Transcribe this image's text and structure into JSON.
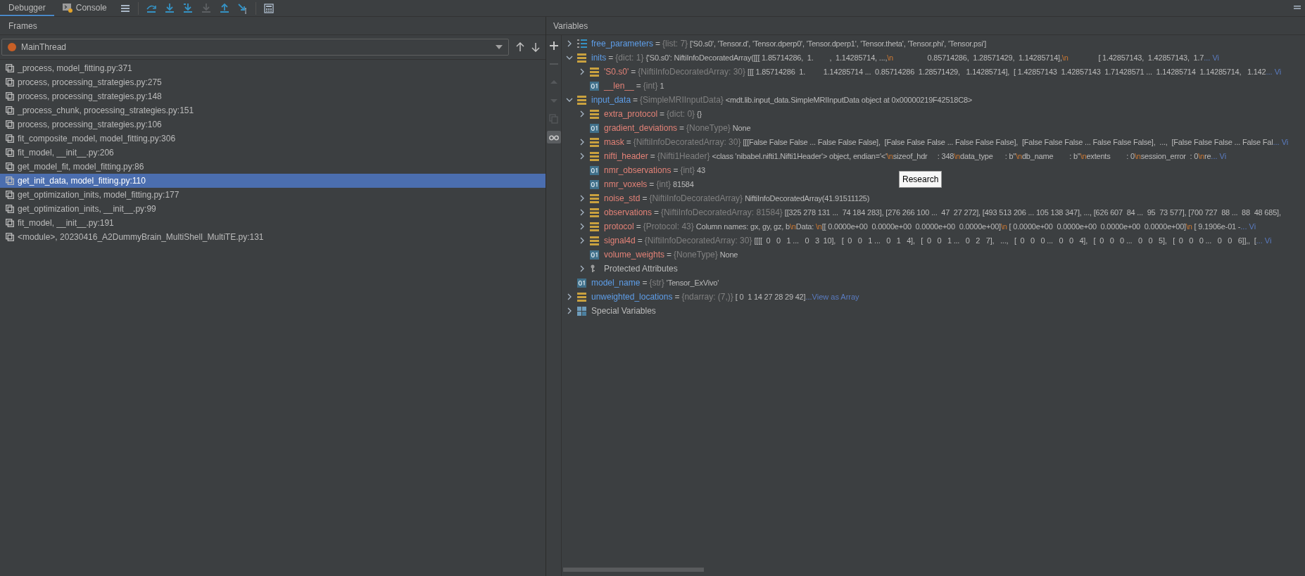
{
  "toolbar": {
    "tabs": [
      {
        "label": "Debugger",
        "selected": true,
        "kind": "plain"
      },
      {
        "label": "Console",
        "selected": false,
        "kind": "console"
      }
    ],
    "actions": [
      {
        "kind": "menu",
        "disabled": false
      },
      {
        "kind": "step-over",
        "disabled": false
      },
      {
        "kind": "step-into",
        "disabled": false
      },
      {
        "kind": "step-into-mine",
        "disabled": false
      },
      {
        "kind": "force-step-into",
        "disabled": true
      },
      {
        "kind": "step-out",
        "disabled": false
      },
      {
        "kind": "run-to-cursor",
        "disabled": false
      },
      {
        "kind": "evaluate",
        "disabled": false
      }
    ]
  },
  "frames": {
    "title": "Frames",
    "thread": {
      "name": "MainThread"
    },
    "items": [
      {
        "label": "_process, model_fitting.py:371",
        "selected": false
      },
      {
        "label": "process, processing_strategies.py:275",
        "selected": false
      },
      {
        "label": "process, processing_strategies.py:148",
        "selected": false
      },
      {
        "label": "_process_chunk, processing_strategies.py:151",
        "selected": false
      },
      {
        "label": "process, processing_strategies.py:106",
        "selected": false
      },
      {
        "label": "fit_composite_model, model_fitting.py:306",
        "selected": false
      },
      {
        "label": "fit_model, __init__.py:206",
        "selected": false
      },
      {
        "label": "get_model_fit, model_fitting.py:86",
        "selected": false
      },
      {
        "label": "get_init_data, model_fitting.py:110",
        "selected": true
      },
      {
        "label": "get_optimization_inits, model_fitting.py:177",
        "selected": false
      },
      {
        "label": "get_optimization_inits, __init__.py:99",
        "selected": false
      },
      {
        "label": "fit_model, __init__.py:191",
        "selected": false
      },
      {
        "label": "<module>, 20230416_A2DummyBrain_MultiShell_MultiTE.py:131",
        "selected": false
      }
    ]
  },
  "variables": {
    "title": "Variables",
    "separator": "=",
    "gutter": [
      {
        "kind": "add",
        "disabled": false,
        "selected": false
      },
      {
        "kind": "remove",
        "disabled": true,
        "selected": false
      },
      {
        "kind": "up",
        "disabled": true,
        "selected": false
      },
      {
        "kind": "down",
        "disabled": true,
        "selected": false
      },
      {
        "kind": "copy",
        "disabled": true,
        "selected": false
      },
      {
        "kind": "watch",
        "disabled": false,
        "selected": true
      }
    ],
    "rows": [
      {
        "kind": "list",
        "name": "free_parameters",
        "type": "{list: 7}",
        "expanded": false,
        "value": [
          {
            "text": "['S0.s0', 'Tensor.d', 'Tensor.dperp0', 'Tensor.dperp1', 'Tensor.theta', 'Tensor.phi', 'Tensor.psi']",
            "escape": false
          }
        ]
      },
      {
        "kind": "bars",
        "name": "inits",
        "type": "{dict: 1}",
        "expanded": true,
        "value": [
          {
            "text": "{'S0.s0': NiftiInfoDecoratedArray([[[ 1.85714286,  1.        ,  1.14285714, ...,",
            "escape": false
          },
          {
            "text": "\\n",
            "escape": true
          },
          {
            "text": "                 0.85714286,  1.28571429,  1.14285714],",
            "escape": false
          },
          {
            "text": "\\n",
            "escape": true
          },
          {
            "text": "               [ 1.42857143,  1.42857143,  1.7",
            "escape": false
          }
        ],
        "link": "... Vi",
        "children": [
          {
            "kind": "bars",
            "name": "'S0.s0'",
            "type": "{NiftiInfoDecoratedArray: 30}",
            "expanded": false,
            "value": [
              {
                "text": "[[[ 1.85714286  1.         1.14285714 ...  0.85714286  1.28571429,   1.14285714],  [ 1.42857143  1.42857143  1.71428571 ...  1.14285714  1.14285714,   1.142",
                "escape": false
              }
            ],
            "link": "... Vi"
          },
          {
            "kind": "int",
            "name": "__len__",
            "type": "{int}",
            "value": [
              {
                "text": "1",
                "escape": false
              }
            ]
          }
        ]
      },
      {
        "kind": "bars",
        "name": "input_data",
        "type": "{SimpleMRIInputData}",
        "expanded": true,
        "value": [
          {
            "text": "<mdt.lib.input_data.SimpleMRIInputData object at 0x00000219F42518C8>",
            "escape": false
          }
        ],
        "children": [
          {
            "kind": "bars",
            "name": "extra_protocol",
            "type": "{dict: 0}",
            "expanded": false,
            "value": [
              {
                "text": "{}",
                "escape": false
              }
            ]
          },
          {
            "kind": "int",
            "name": "gradient_deviations",
            "type": "{NoneType}",
            "value": [
              {
                "text": "None",
                "escape": false
              }
            ]
          },
          {
            "kind": "bars",
            "name": "mask",
            "type": "{NiftiInfoDecoratedArray: 30}",
            "expanded": false,
            "value": [
              {
                "text": "[[[False False False ... False False False],  [False False False ... False False False],  [False False False ... False False False],  ...,  [False False False ... False Fal",
                "escape": false
              }
            ],
            "link": "... Vi"
          },
          {
            "kind": "bars",
            "name": "nifti_header",
            "type": "{Nifti1Header}",
            "expanded": false,
            "value": [
              {
                "text": "<class 'nibabel.nifti1.Nifti1Header'> object, endian='<'",
                "escape": false
              },
              {
                "text": "\\n",
                "escape": true
              },
              {
                "text": "sizeof_hdr     : 348",
                "escape": false
              },
              {
                "text": "\\n",
                "escape": true
              },
              {
                "text": "data_type      : b''",
                "escape": false
              },
              {
                "text": "\\n",
                "escape": true
              },
              {
                "text": "db_name        : b''",
                "escape": false
              },
              {
                "text": "\\n",
                "escape": true
              },
              {
                "text": "extents        : 0",
                "escape": false
              },
              {
                "text": "\\n",
                "escape": true
              },
              {
                "text": "session_error  : 0",
                "escape": false
              },
              {
                "text": "\\n",
                "escape": true
              },
              {
                "text": "re",
                "escape": false
              }
            ],
            "link": "... Vi"
          },
          {
            "kind": "int",
            "name": "nmr_observations",
            "type": "{int}",
            "value": [
              {
                "text": "43",
                "escape": false
              }
            ]
          },
          {
            "kind": "int",
            "name": "nmr_voxels",
            "type": "{int}",
            "value": [
              {
                "text": "81584",
                "escape": false
              }
            ]
          },
          {
            "kind": "bars",
            "name": "noise_std",
            "type": "{NiftiInfoDecoratedArray}",
            "expanded": false,
            "value": [
              {
                "text": "NiftiInfoDecoratedArray(41.91511125)",
                "escape": false
              }
            ]
          },
          {
            "kind": "bars",
            "name": "observations",
            "type": "{NiftiInfoDecoratedArray: 81584}",
            "expanded": false,
            "value": [
              {
                "text": "[[325 278 131 ...  74 184 283], [276 266 100 ...  47  27 272], [493 513 206 ... 105 138 347], ..., [626 607  84 ...  95  73 577], [700 727  88 ...  88  48 685],",
                "escape": false
              }
            ]
          },
          {
            "kind": "bars",
            "name": "protocol",
            "type": "{Protocol: 43}",
            "expanded": false,
            "value": [
              {
                "text": "Column names: gx, gy, gz, b",
                "escape": false
              },
              {
                "text": "\\n",
                "escape": true
              },
              {
                "text": "Data: ",
                "escape": false
              },
              {
                "text": "\\n",
                "escape": true
              },
              {
                "text": "[[ 0.0000e+00  0.0000e+00  0.0000e+00  0.0000e+00]",
                "escape": false
              },
              {
                "text": "\\n",
                "escape": true
              },
              {
                "text": " [ 0.0000e+00  0.0000e+00  0.0000e+00  0.0000e+00]",
                "escape": false
              },
              {
                "text": "\\n",
                "escape": true
              },
              {
                "text": " [ 9.1906e-01 -",
                "escape": false
              }
            ],
            "link": "... Vi"
          },
          {
            "kind": "bars",
            "name": "signal4d",
            "type": "{NiftiInfoDecoratedArray: 30}",
            "expanded": false,
            "value": [
              {
                "text": "[[[[  0   0   1 ...   0   3  10],   [  0   0   1 ...   0   1   4],   [  0   0   1 ...   0   2   7],   ...,   [  0   0   0 ...   0   0   4],   [  0   0   0 ...   0   0   5],   [  0   0   0 ...   0   0   6]],,  [",
                "escape": false
              }
            ],
            "link": "... Vi"
          },
          {
            "kind": "int",
            "name": "volume_weights",
            "type": "{NoneType}",
            "value": [
              {
                "text": "None",
                "escape": false
              }
            ]
          },
          {
            "kind": "protected",
            "name": "Protected Attributes",
            "expanded": false
          }
        ]
      },
      {
        "kind": "int",
        "name": "model_name",
        "type": "{str}",
        "value": [
          {
            "text": "'Tensor_ExVivo'",
            "escape": false
          }
        ]
      },
      {
        "kind": "bars",
        "name": "unweighted_locations",
        "type": "{ndarray: (7,)}",
        "expanded": false,
        "value": [
          {
            "text": "[ 0  1 14 27 28 29 42]",
            "escape": false
          }
        ],
        "link": "...View as Array"
      },
      {
        "kind": "special",
        "name": "Special Variables",
        "expanded": false
      }
    ]
  },
  "tooltip": "Research"
}
